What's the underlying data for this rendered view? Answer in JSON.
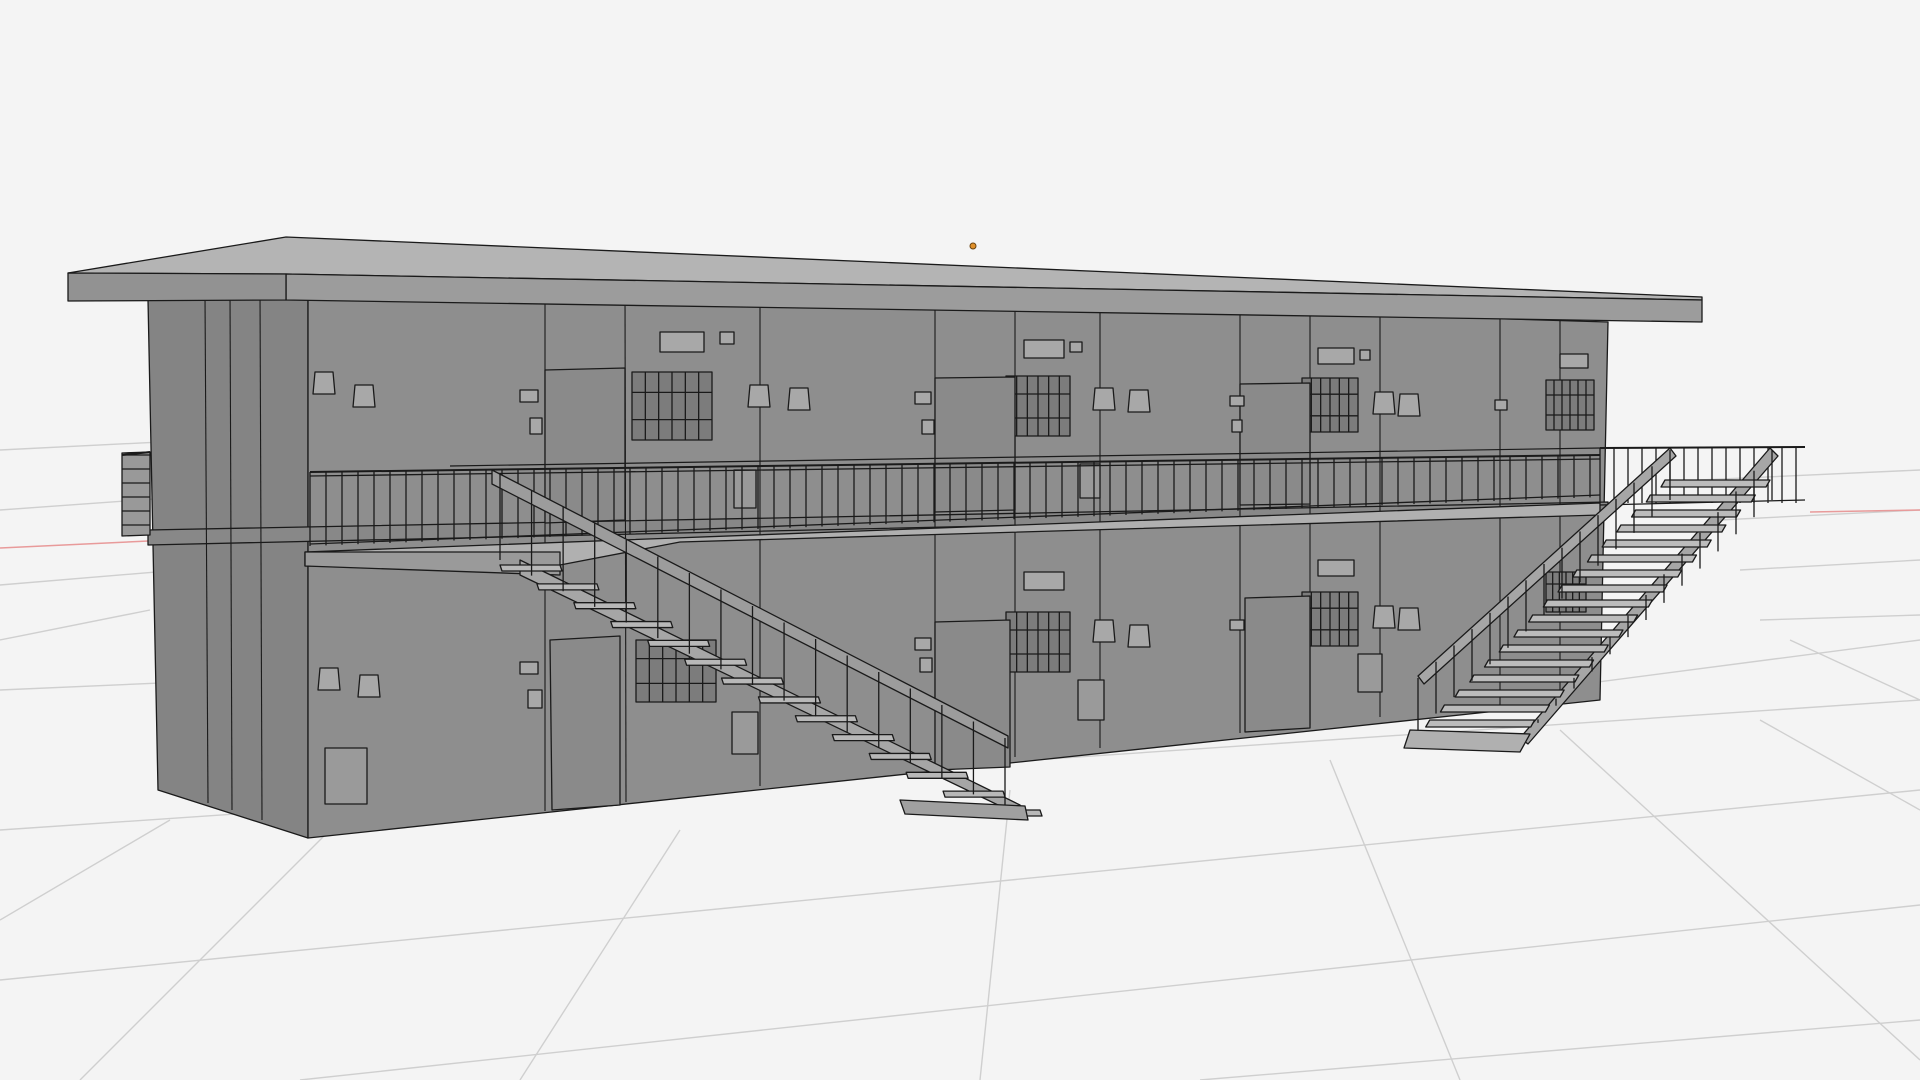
{
  "viewport": {
    "background": "#f4f4f4",
    "grid_color": "#cfcfcf",
    "x_axis_color": "#e89a9a",
    "object_fill": "#8e8e8e",
    "roof_fill": "#9c9c9c",
    "roof_top_fill": "#b4b4b4",
    "wire_color": "#1a1a1a",
    "origin_color": "#e0902a"
  },
  "scene_object": {
    "icon": "building-wireframe-icon"
  }
}
